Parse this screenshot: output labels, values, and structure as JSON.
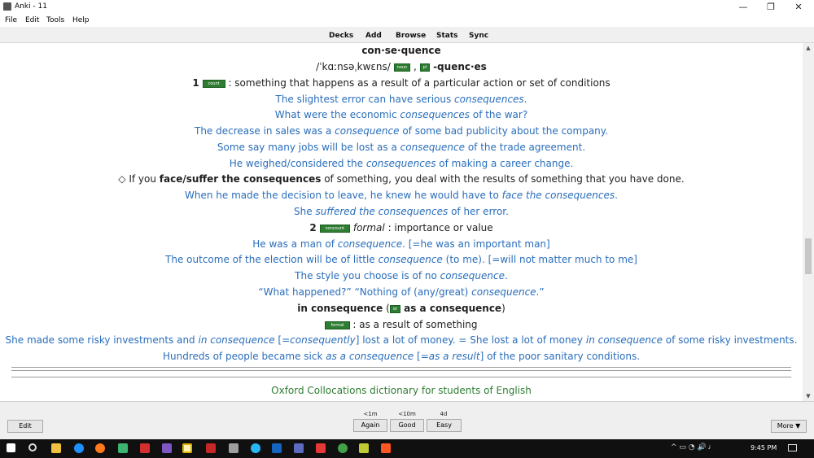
{
  "window": {
    "title": "Anki - 11"
  },
  "menu": [
    "File",
    "Edit",
    "Tools",
    "Help"
  ],
  "toolbar": [
    "Decks",
    "Add",
    "Browse",
    "Stats",
    "Sync"
  ],
  "entry": {
    "headword": "con·se·quence",
    "pron_pre": "/ˈkɑːnsəˌkwɛns/",
    "pos_tag": "noun",
    "pl_tag": "pl",
    "plural": "-quenc·es",
    "sense1_num": "1",
    "sense1_tag": "count",
    "sense1_def": ": something that happens as a result of a particular action or set of conditions",
    "ex1": {
      "a": "The slightest error can have serious ",
      "b": "consequences",
      "c": "."
    },
    "ex2": {
      "a": "What were the economic ",
      "b": "consequences",
      "c": " of the war?"
    },
    "ex3": {
      "a": "The decrease in sales was a ",
      "b": "consequence",
      "c": " of some bad publicity about the company."
    },
    "ex4": {
      "a": "Some say many jobs will be lost as a ",
      "b": "consequence",
      "c": " of the trade agreement."
    },
    "ex5": {
      "a": "He weighed/considered the ",
      "b": "consequences",
      "c": " of making a career change."
    },
    "idiom": {
      "a": "◇ If you ",
      "b": "face/suffer the consequences",
      "c": " of something, you deal with the results of something that you have done."
    },
    "ex6": {
      "a": "When he made the decision to leave, he knew he would have to ",
      "b": "face the consequences",
      "c": "."
    },
    "ex7": {
      "a": "She ",
      "b": "suffered the consequences",
      "c": " of her error."
    },
    "sense2_num": "2",
    "sense2_tag": "noncount",
    "sense2_formal": "formal",
    "sense2_def": ": importance or value",
    "ex8": {
      "a": "He was a man of ",
      "b": "consequence",
      "c": ". [=he was an important man]"
    },
    "ex9": {
      "a": "The outcome of the election will be of little ",
      "b": "consequence",
      "c": " (to me). [=will not matter much to me]"
    },
    "ex10": {
      "a": "The style you choose is of no ",
      "b": "consequence",
      "c": "."
    },
    "ex11": {
      "a": "“What happened?” “Nothing of (any/great) ",
      "b": "consequence",
      "c": ".”"
    },
    "phrase": {
      "a": "in consequence",
      "open": " (",
      "tag": "or",
      "b": " as a consequence",
      "close": ")"
    },
    "phrase_tag": "formal",
    "phrase_def": ": as a result of something",
    "ex12": {
      "a": "She made some risky investments and ",
      "b": "in consequence",
      "c": " [=",
      "d": "consequently",
      "e": "] lost a lot of money. = She lost a lot of money ",
      "f": "in consequence",
      "g": " of some risky investments."
    },
    "ex13": {
      "a": "Hundreds of people became sick ",
      "b": "as a consequence",
      "c": " [=",
      "d": "as a result",
      "e": "] of the poor sanitary conditions."
    },
    "footer": "Oxford Collocations dictionary for students of English"
  },
  "review": {
    "edit_label": "Edit",
    "more_label": "More ▼",
    "buttons": [
      {
        "interval": "<1m",
        "label": "Again"
      },
      {
        "interval": "<10m",
        "label": "Good"
      },
      {
        "interval": "4d",
        "label": "Easy"
      }
    ]
  },
  "taskbar": {
    "clock": "9:45 PM",
    "tray": "^ ▭ ◔ 🔊 ﺗ"
  },
  "colors": {
    "example": "#2a6ebb",
    "tag": "#2e7d32"
  }
}
